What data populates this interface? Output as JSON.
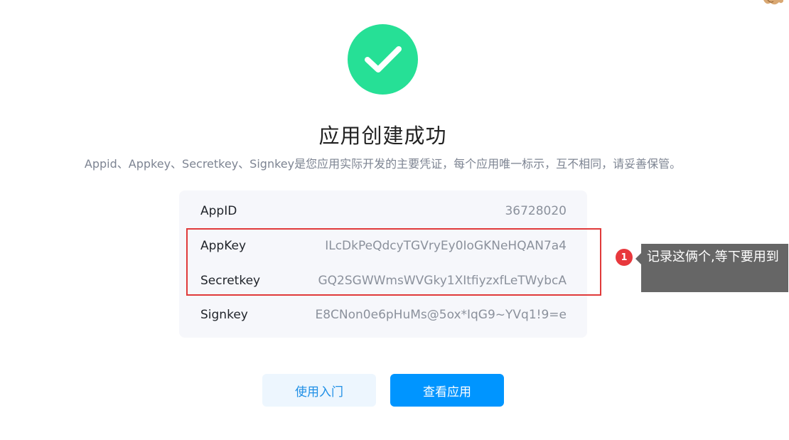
{
  "success_icon": {
    "name": "check-icon",
    "color": "#26e096"
  },
  "title": "应用创建成功",
  "subtitle": "Appid、Appkey、Secretkey、Signkey是您应用实际开发的主要凭证，每个应用唯一标示，互不相同，请妥善保管。",
  "credentials": [
    {
      "label": "AppID",
      "value": "36728020"
    },
    {
      "label": "AppKey",
      "value": "ILcDkPeQdcyTGVryEy0IoGKNeHQAN7a4"
    },
    {
      "label": "Secretkey",
      "value": "GQ2SGWWmsWVGky1XItfiyzxfLeTWybcA"
    },
    {
      "label": "Signkey",
      "value": "E8CNon0e6pHuMs@5ox*IqG9~YVq1!9=e"
    }
  ],
  "annotation": {
    "badge_number": "1",
    "note": "记录这俩个,等下要用到",
    "highlight_color": "#e03a3a"
  },
  "buttons": {
    "getting_started": "使用入门",
    "view_app": "查看应用"
  },
  "colors": {
    "primary": "#0095ff",
    "secondary_bg": "#edf6fe"
  }
}
